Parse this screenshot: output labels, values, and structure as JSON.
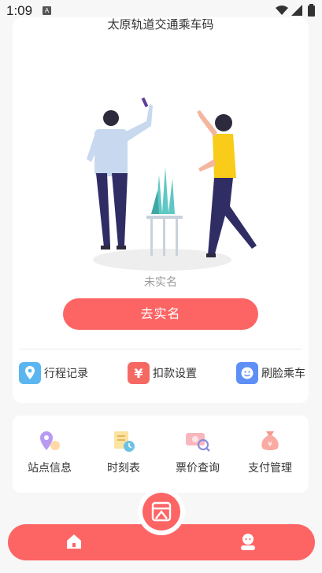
{
  "status_bar": {
    "time": "1:09",
    "notification_letter": "A"
  },
  "header": {
    "title": "太原轨道交通乘车码"
  },
  "verification": {
    "status_text": "未实名",
    "button_label": "去实名"
  },
  "quick_actions": [
    {
      "label": "行程记录",
      "icon": "location-pin-icon",
      "color": "#5bb6f0"
    },
    {
      "label": "扣款设置",
      "icon": "yen-icon",
      "color": "#f46a63"
    },
    {
      "label": "刷脸乘车",
      "icon": "face-icon",
      "color": "#5e8ff4"
    }
  ],
  "services": [
    {
      "label": "站点信息",
      "icon": "station-pin-icon"
    },
    {
      "label": "时刻表",
      "icon": "schedule-icon"
    },
    {
      "label": "票价查询",
      "icon": "ticket-search-icon"
    },
    {
      "label": "支付管理",
      "icon": "money-bag-icon"
    }
  ],
  "tab_bar": {
    "items": [
      {
        "name": "home",
        "icon": "home-icon"
      },
      {
        "name": "center",
        "icon": "ticket-qrcode-icon"
      },
      {
        "name": "profile",
        "icon": "user-icon"
      }
    ],
    "accent": "#fd6565"
  }
}
